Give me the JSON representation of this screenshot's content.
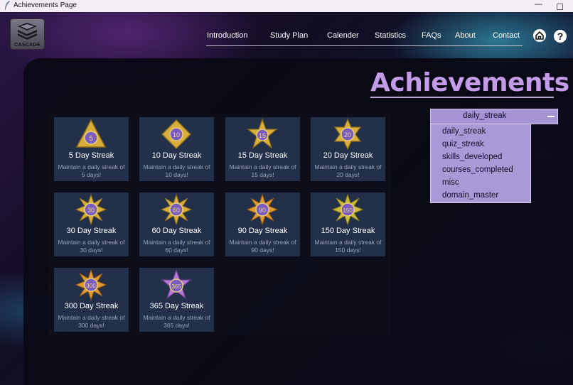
{
  "window": {
    "title": "Achievements Page",
    "min_glyph": "—"
  },
  "logo": {
    "label": "CASCADE"
  },
  "nav": [
    "Introduction",
    "Study Plan",
    "Calender",
    "Statistics",
    "FAQs",
    "About",
    "Contact"
  ],
  "help": "?",
  "page_title": "Achievements",
  "dropdown": {
    "selected": "daily_streak",
    "options": [
      "daily_streak",
      "quiz_streak",
      "skills_developed",
      "courses_completed",
      "misc",
      "domain_master"
    ]
  },
  "achievements": [
    {
      "badge": "5",
      "name": "5 Day Streak",
      "desc": "Maintain a daily streak of 5 days!"
    },
    {
      "badge": "10",
      "name": "10 Day Streak",
      "desc": "Maintain a daily streak of 10 days!"
    },
    {
      "badge": "15",
      "name": "15 Day Streak",
      "desc": "Maintain a daily streak of 15 days!"
    },
    {
      "badge": "20",
      "name": "20 Day Streak",
      "desc": "Maintain a daily streak of 20 days!"
    },
    {
      "badge": "30",
      "name": "30 Day Streak",
      "desc": "Maintain a daily streak of 30 days!"
    },
    {
      "badge": "60",
      "name": "60 Day Streak",
      "desc": "Maintain a daily streak of 60 days!"
    },
    {
      "badge": "90",
      "name": "90 Day Streak",
      "desc": "Maintain a daily streak of 90 days!"
    },
    {
      "badge": "150",
      "name": "150 Day Streak",
      "desc": "Maintain a daily streak of 150 days!"
    },
    {
      "badge": "300",
      "name": "300 Day Streak",
      "desc": "Maintain a daily streak of 300 days!"
    },
    {
      "badge": "365",
      "name": "365 Day Streak",
      "desc": "Maintain a daily streak of 365 days!"
    }
  ],
  "colors": {
    "accent": "#c39be6",
    "card": "#223049",
    "dropdown": "#a593d6"
  }
}
